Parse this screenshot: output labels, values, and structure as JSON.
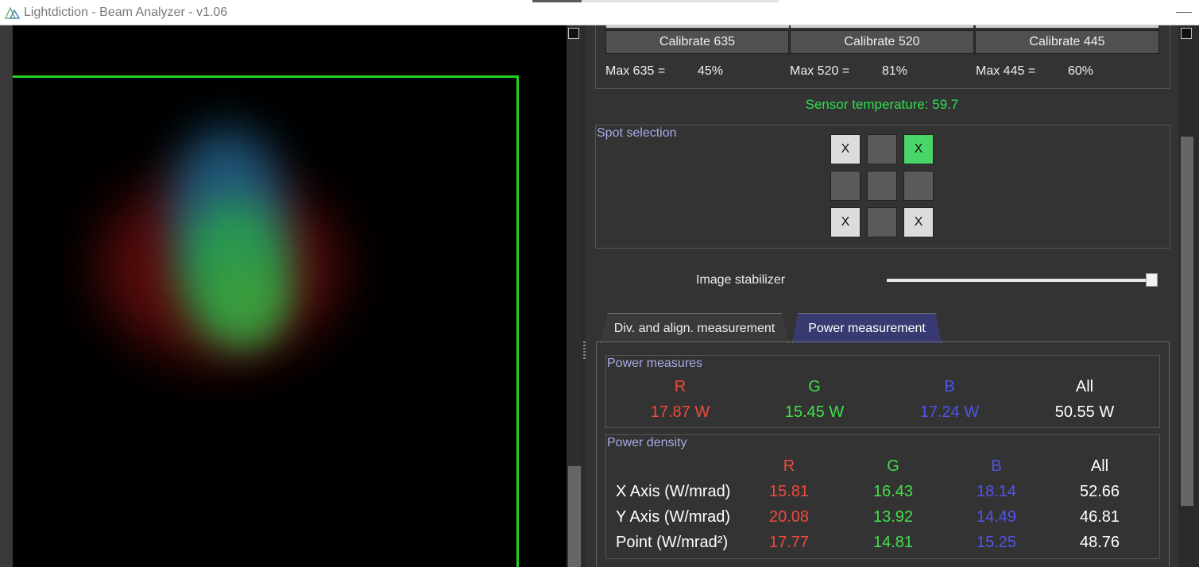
{
  "window": {
    "title": "Lightdiction - Beam Analyzer - v1.06"
  },
  "calibration": {
    "buttons": [
      "Calibrate 635",
      "Calibrate 520",
      "Calibrate 445"
    ],
    "max": [
      {
        "label": "Max 635 =",
        "value": "45%"
      },
      {
        "label": "Max 520 =",
        "value": "81%"
      },
      {
        "label": "Max 445 =",
        "value": "60%"
      }
    ]
  },
  "sensor": {
    "text": "Sensor temperature: 59.7"
  },
  "spot_selection": {
    "title": "Spot selection",
    "grid": [
      [
        "X",
        "",
        "X"
      ],
      [
        "",
        "",
        ""
      ],
      [
        "X",
        "",
        "X"
      ]
    ],
    "active_cell": "0-2"
  },
  "stabilizer": {
    "label": "Image stabilizer",
    "level_fraction": 1.0
  },
  "tabs": [
    {
      "label": "Div. and align. measurement",
      "selected": false
    },
    {
      "label": "Power measurement",
      "selected": true
    }
  ],
  "power_measures": {
    "title": "Power measures",
    "headers": [
      "R",
      "G",
      "B",
      "All"
    ],
    "values": [
      "17.87 W",
      "15.45 W",
      "17.24 W",
      "50.55 W"
    ]
  },
  "power_density": {
    "title": "Power density",
    "headers": [
      "R",
      "G",
      "B",
      "All"
    ],
    "rows": [
      {
        "label": "X Axis (W/mrad)",
        "values": [
          "15.81",
          "16.43",
          "18.14",
          "52.66"
        ]
      },
      {
        "label": "Y Axis (W/mrad)",
        "values": [
          "20.08",
          "13.92",
          "14.49",
          "46.81"
        ]
      },
      {
        "label": "Point (W/mrad²)",
        "values": [
          "17.77",
          "14.81",
          "15.25",
          "48.76"
        ]
      }
    ]
  },
  "colors": {
    "red": "#ef4a3d",
    "green": "#41e04a",
    "blue": "#4f55e8",
    "roi": "#21d321",
    "tab_active": "#3a3a72"
  }
}
